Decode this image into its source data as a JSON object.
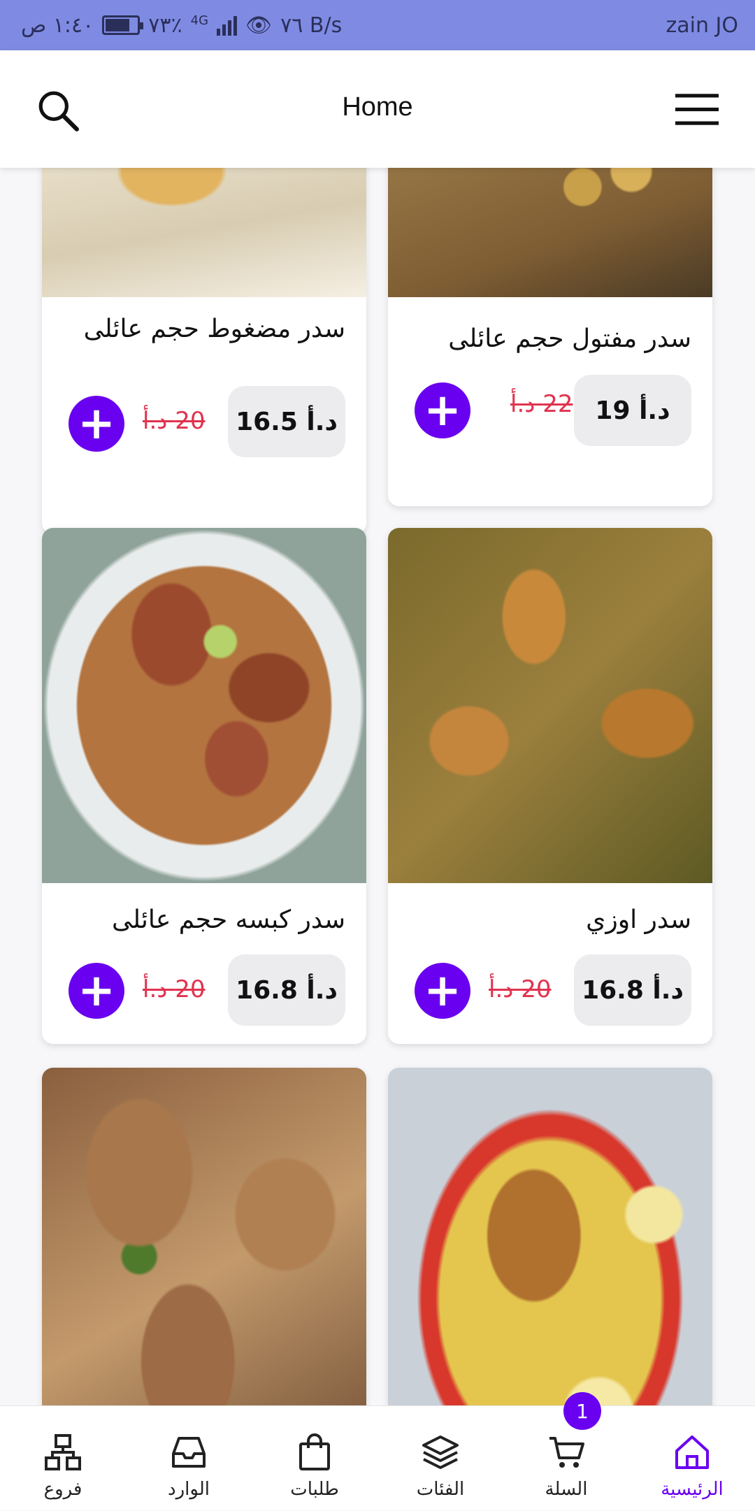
{
  "status_bar": {
    "time": "١:٤٠ ص",
    "battery": "٧٣٪",
    "battery_level": 0.73,
    "network": "4G",
    "speed": "٧٦ B/s",
    "carrier": "zain JO"
  },
  "header": {
    "title": "Home",
    "search_icon": "search-icon",
    "menu_icon": "hamburger-menu-icon"
  },
  "products": [
    {
      "name": "سدر مفتول حجم عائلى",
      "price": "د.أ 19",
      "old_price": "22 د.أ",
      "image_colors": [
        "#8b6a3c",
        "#a57f4a",
        "#6b4f2a"
      ]
    },
    {
      "name": "سدر مضغوط حجم عائلى",
      "price": "د.أ 16.5",
      "old_price": "20 د.أ",
      "image_colors": [
        "#e7dfc9",
        "#d9b06a",
        "#f2ebe0"
      ]
    },
    {
      "name": "سدر اوزي",
      "price": "د.أ 16.8",
      "old_price": "20 د.أ",
      "image_colors": [
        "#8a6b2e",
        "#b58a3f",
        "#5c6b23"
      ]
    },
    {
      "name": "سدر كبسه حجم عائلى",
      "price": "د.أ 16.8",
      "old_price": "20 د.أ",
      "image_colors": [
        "#a1653a",
        "#4f6b2a",
        "#c28a55"
      ]
    },
    {
      "name": "",
      "image_colors": [
        "#e6c84a",
        "#b06a2a",
        "#d23a2a"
      ]
    },
    {
      "name": "",
      "image_colors": [
        "#9b6a45",
        "#5e7a36",
        "#c99a6a"
      ]
    }
  ],
  "add_label": "+",
  "bottom_nav": {
    "items": [
      {
        "label": "الرئيسية",
        "icon": "home-icon"
      },
      {
        "label": "السلة",
        "icon": "cart-icon"
      },
      {
        "label": "الفئات",
        "icon": "layers-icon"
      },
      {
        "label": "طلبات",
        "icon": "shopping-bag-icon"
      },
      {
        "label": "الوارد",
        "icon": "inbox-icon"
      },
      {
        "label": "فروع",
        "icon": "branches-icon"
      }
    ],
    "cart_count": "1",
    "active": "الرئيسية"
  },
  "colors": {
    "accent": "#6a00f0",
    "status_bar": "#7f8be3",
    "old_price": "#e0334f"
  }
}
